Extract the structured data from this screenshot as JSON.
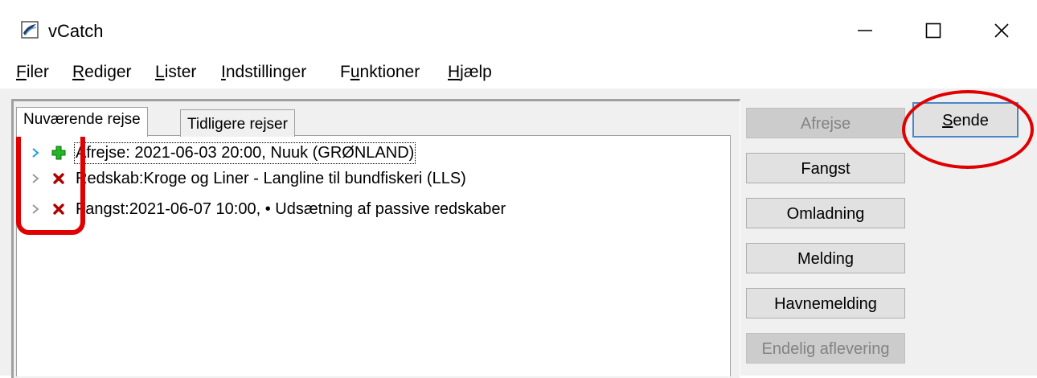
{
  "window": {
    "title": "vCatch",
    "controls": {
      "minimize_icon": "minimize-icon",
      "maximize_icon": "maximize-icon",
      "close_icon": "close-icon"
    }
  },
  "menu": {
    "items": [
      {
        "label": "Filer",
        "mnemonic": "F",
        "rest": "iler"
      },
      {
        "label": "Rediger",
        "mnemonic": "R",
        "rest": "ediger"
      },
      {
        "label": "Lister",
        "mnemonic": "L",
        "rest": "ister"
      },
      {
        "label": "Indstillinger",
        "mnemonic": "I",
        "rest": "ndstillinger"
      },
      {
        "label": "Funktioner",
        "pre": "F",
        "mnemonic": "u",
        "rest": "nktioner"
      },
      {
        "label": "Hjælp",
        "mnemonic": "H",
        "rest": "jælp"
      }
    ]
  },
  "tabs": {
    "current": "Nuværende rejse",
    "previous": "Tidligere rejser"
  },
  "tree": {
    "items": [
      {
        "label": "Afrejse: 2021-06-03 20:00,  Nuuk (GRØNLAND)",
        "status_icon": "plus-icon",
        "status_color": "#22b822",
        "selected": true
      },
      {
        "label": "Redskab:Kroge og Liner - Langline til bundfiskeri (LLS)",
        "status_icon": "cross-icon",
        "status_color": "#b00000",
        "selected": false
      },
      {
        "label": "Fangst:2021-06-07 10:00, • Udsætning af passive redskaber",
        "status_icon": "cross-icon",
        "status_color": "#b00000",
        "selected": false
      }
    ]
  },
  "buttons": {
    "afrejse": "Afrejse",
    "fangst": "Fangst",
    "omladning": "Omladning",
    "melding": "Melding",
    "havnemelding": "Havnemelding",
    "endelig": "Endelig aflevering",
    "sende_mnemonic": "S",
    "sende_rest": "ende"
  },
  "colors": {
    "annotation": "#e00000",
    "selected_chevron": "#1a9fe0",
    "default_chevron": "#9a9a9a"
  }
}
